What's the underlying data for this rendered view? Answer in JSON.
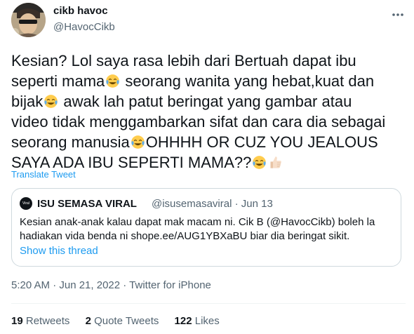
{
  "author": {
    "name": "cikb havoc",
    "handle": "@HavocCikb"
  },
  "tweet": {
    "lines": [
      [
        "Kesian? Lol saya rasa lebih dari Bertuah dapat ibu"
      ],
      [
        "seperti mama",
        "joy",
        " seorang wanita yang hebat,kuat dan"
      ],
      [
        "bijak",
        "joy",
        " awak lah patut beringat yang gambar atau"
      ],
      [
        "video tidak menggambarkan sifat dan cara dia sebagai"
      ],
      [
        "seorang manusia",
        "joy",
        "OHHHH OR CUZ YOU JEALOUS"
      ],
      [
        "SAYA ADA IBU SEPERTI MAMA??",
        "joy",
        "thumbs"
      ]
    ],
    "line_texts": [
      "Kesian? Lol saya rasa lebih dari Bertuah dapat ibu",
      "seperti mama",
      " seorang wanita yang hebat,kuat dan",
      "bijak",
      " awak lah patut beringat yang gambar atau",
      "video tidak menggambarkan sifat dan cara dia sebagai",
      "seorang manusia",
      "OHHHH OR CUZ YOU JEALOUS",
      "SAYA ADA IBU SEPERTI MAMA??"
    ],
    "translate_label": "Translate Tweet"
  },
  "quote": {
    "avatar_text": "Viral",
    "name": "ISU SEMASA VIRAL",
    "handle_date": "@isusemasaviral · Jun 13",
    "line1": "Kesian anak-anak kalau dapat mak macam ni. Cik B (@HavocCikb) boleh la",
    "line2": "hadiakan  vida benda ni shope.ee/AUG1YBXaBU biar dia beringat sikit.",
    "show_thread": "Show this thread"
  },
  "meta": "5:20 AM · Jun 21, 2022 · Twitter for iPhone",
  "stats": {
    "retweets_count": "19",
    "retweets_label": "Retweets",
    "quotes_count": "2",
    "quotes_label": "Quote Tweets",
    "likes_count": "122",
    "likes_label": "Likes"
  },
  "icons": {
    "more": "more-dots-icon",
    "emoji_joy": "face-with-tears-of-joy-icon",
    "emoji_thumbs": "thumbs-up-icon"
  },
  "colors": {
    "link": "#1d9bf0",
    "secondary_text": "#536471",
    "border": "#cfd9de"
  }
}
